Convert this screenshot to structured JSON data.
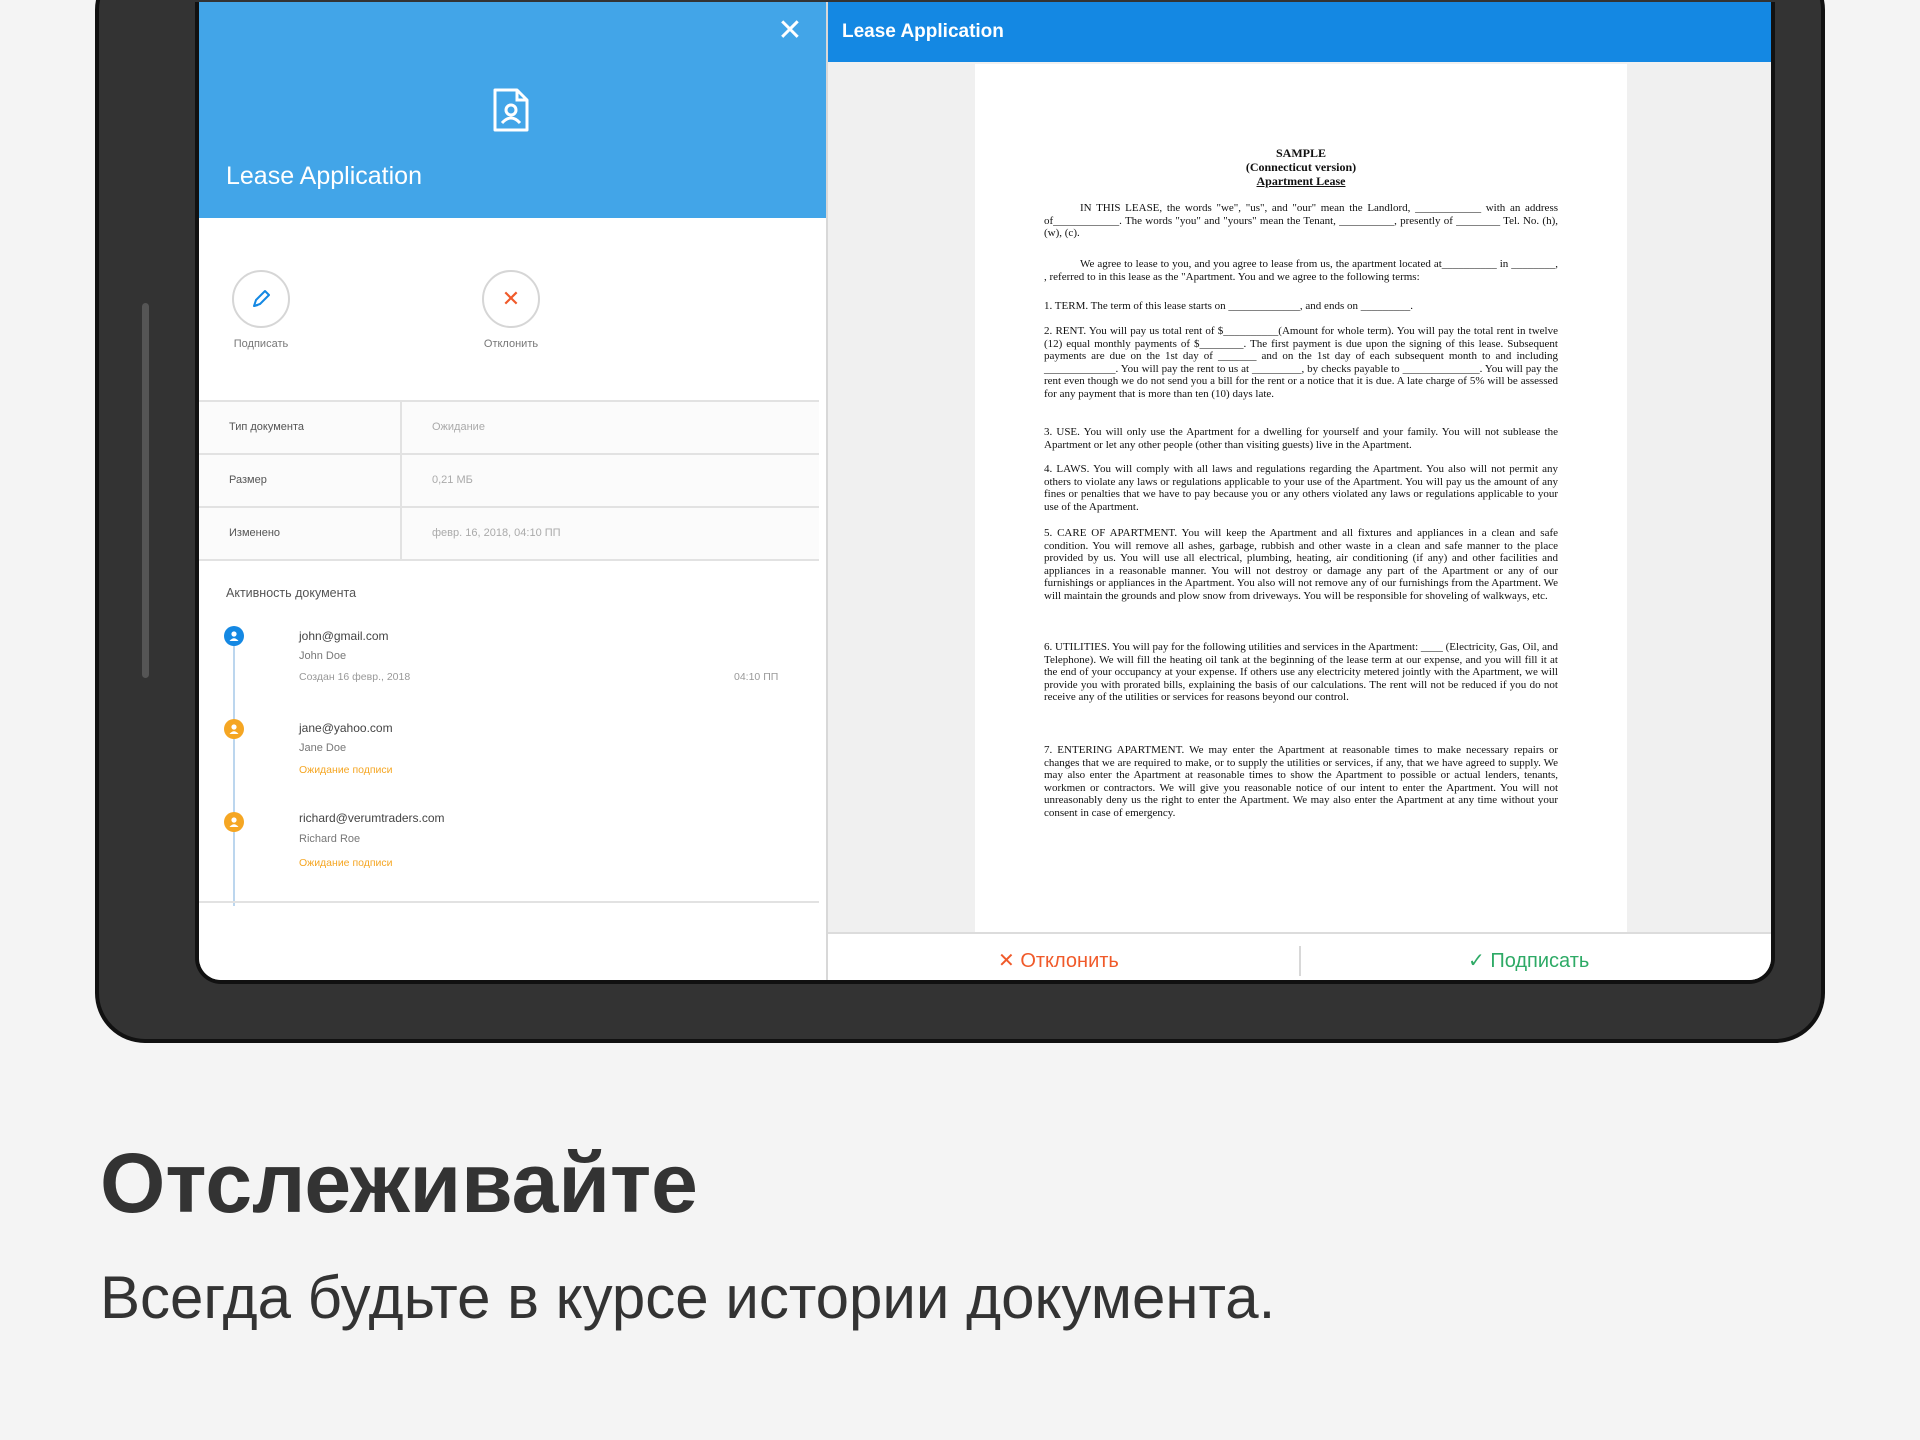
{
  "left_panel": {
    "title": "Lease Application",
    "actions": {
      "sign_label": "Подписать",
      "decline_label": "Отклонить"
    },
    "properties": [
      {
        "key": "Тип документа",
        "value": "Ожидание"
      },
      {
        "key": "Размер",
        "value": "0,21 МБ"
      },
      {
        "key": "Изменено",
        "value": "февр. 16, 2018, 04:10 ПП"
      }
    ],
    "activity_title": "Активность документа",
    "activity": [
      {
        "email": "john@gmail.com",
        "name": "John Doe",
        "status": "Создан 16 февр., 2018",
        "time": "04:10 ПП",
        "color": "#1488e3"
      },
      {
        "email": "jane@yahoo.com",
        "name": "Jane Doe",
        "status": "Ожидание подписи",
        "time": "",
        "color": "#f5a623"
      },
      {
        "email": "richard@verumtraders.com",
        "name": "Richard Roe",
        "status": "Ожидание подписи",
        "time": "",
        "color": "#f5a623"
      }
    ]
  },
  "right_panel": {
    "title": "Lease Application",
    "decline_label": "✕ Отклонить",
    "sign_label": "✓ Подписать",
    "document": {
      "heading1": "SAMPLE",
      "heading2": "(Connecticut version)",
      "heading3": "Apartment Lease",
      "paragraphs": [
        "IN THIS LEASE, the words \"we\", \"us\", and \"our\" mean the Landlord, ____________ with an address of____________. The words \"you\" and \"yours\" mean the Tenant, __________, presently of ________ Tel. No. (h), (w), (c).",
        "We agree to lease to you, and you agree to lease from us, the apartment located at__________ in ________, , referred to in this lease as the \"Apartment. You and we agree to the following terms:",
        "1. TERM. The term of this lease starts on _____________, and ends on _________.",
        "2. RENT. You will pay us total rent of $__________(Amount for whole term). You will pay the total rent in twelve (12) equal monthly payments of $________. The first payment is due upon the signing of this lease. Subsequent payments are due on the 1st day of _______ and on the 1st day of each subsequent month to and including _____________. You will pay the rent to us at _________, by checks payable to ______________. You will pay the rent even though we do not send you a bill for the rent or a notice that it is due. A late charge of 5% will be assessed for any payment that is more than ten (10) days late.",
        "3. USE. You will only use the Apartment for a dwelling for yourself and your family. You will not sublease the Apartment or let any other people (other than visiting guests) live in the Apartment.",
        "4. LAWS. You will comply with all laws and regulations regarding the Apartment. You also will not permit any others to violate any laws or regulations applicable to your use of the Apartment. You will pay us the amount of any fines or penalties that we have to pay because you or any others violated any laws or regulations applicable to your use of the Apartment.",
        "5. CARE OF APARTMENT. You will keep the Apartment and all fixtures and appliances in a clean and safe condition. You will remove all ashes, garbage, rubbish and other waste in a clean and safe manner to the place provided by us. You will use all electrical, plumbing, heating, air conditioning (if any) and other facilities and appliances in a reasonable manner. You will not destroy or damage any part of the Apartment or any of our furnishings or appliances in the Apartment. You also will not remove any of our furnishings from the Apartment. We will maintain the grounds and plow snow from driveways. You will be responsible for shoveling of walkways, etc.",
        "6. UTILITIES. You will pay for the following utilities and services in the Apartment: ____ (Electricity, Gas, Oil, and Telephone). We will fill the heating oil tank at the beginning of the lease term at our expense, and you will fill it at the end of your occupancy at your expense. If others use any electricity metered jointly with the Apartment, we will provide you with prorated bills, explaining the basis of our calculations. The rent will not be reduced if you do not receive any of the utilities or services for reasons beyond our control.",
        "7. ENTERING APARTMENT. We may enter the Apartment at reasonable times to make necessary repairs or changes that we are required to make, or to supply the utilities or services, if any, that we have agreed to supply. We may also enter the Apartment at reasonable times to show the Apartment to possible or actual lenders, tenants, workmen or contractors. We will give you reasonable notice of our intent to enter the Apartment. You will not unreasonably deny us the right to enter the Apartment. We may also enter the Apartment at any time without your consent in case of emergency."
      ]
    }
  },
  "promo": {
    "headline": "Отслеживайте",
    "subline": "Всегда будьте в курсе истории документа."
  },
  "colors": {
    "left_header": "#42a5e8",
    "right_header": "#1488e3",
    "decline": "#f05a2a",
    "sign": "#2eaa66",
    "pending": "#f5a623"
  }
}
